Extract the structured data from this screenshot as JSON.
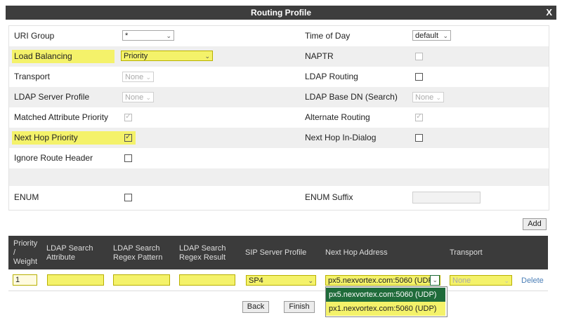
{
  "window": {
    "title": "Routing Profile",
    "close_label": "X"
  },
  "form": {
    "uri_group": {
      "label": "URI Group",
      "value": "*"
    },
    "time_of_day": {
      "label": "Time of Day",
      "value": "default"
    },
    "load_balancing": {
      "label": "Load Balancing",
      "value": "Priority"
    },
    "naptr": {
      "label": "NAPTR",
      "checked": false,
      "disabled": true
    },
    "transport": {
      "label": "Transport",
      "value": "None"
    },
    "ldap_routing": {
      "label": "LDAP Routing",
      "checked": false
    },
    "ldap_server_profile": {
      "label": "LDAP Server Profile",
      "value": "None"
    },
    "ldap_base_dn": {
      "label": "LDAP Base DN (Search)",
      "value": "None"
    },
    "matched_attribute_priority": {
      "label": "Matched Attribute Priority",
      "checked": true,
      "disabled": true
    },
    "alternate_routing": {
      "label": "Alternate Routing",
      "checked": true,
      "disabled": true
    },
    "next_hop_priority": {
      "label": "Next Hop Priority",
      "checked": true
    },
    "next_hop_in_dialog": {
      "label": "Next Hop In-Dialog",
      "checked": false
    },
    "ignore_route_header": {
      "label": "Ignore Route Header",
      "checked": false
    },
    "enum": {
      "label": "ENUM",
      "checked": false
    },
    "enum_suffix": {
      "label": "ENUM Suffix",
      "value": ""
    }
  },
  "buttons": {
    "add": "Add",
    "back": "Back",
    "finish": "Finish",
    "delete": "Delete"
  },
  "table": {
    "headers": {
      "priority_weight": [
        "Priority",
        "/",
        "Weight"
      ],
      "ldap_search_attribute": [
        "LDAP Search",
        "Attribute"
      ],
      "ldap_search_regex_pattern": [
        "LDAP Search",
        "Regex Pattern"
      ],
      "ldap_search_regex_result": [
        "LDAP Search",
        "Regex Result"
      ],
      "sip_server_profile": "SIP Server Profile",
      "next_hop_address": "Next Hop Address",
      "transport": "Transport"
    },
    "row": {
      "priority_weight": "1",
      "ldap_search_attribute": "",
      "ldap_search_regex_pattern": "",
      "ldap_search_regex_result": "",
      "sip_server_profile": "SP4",
      "next_hop_address": "px5.nexvortex.com:5060 (UDP)",
      "transport": "None"
    },
    "next_hop_options": [
      "px5.nexvortex.com:5060 (UDP)",
      "px1.nexvortex.com:5060 (UDP)"
    ]
  },
  "colors": {
    "highlight": "#f4f26a",
    "header_bg": "#3b3b3b",
    "selected_option": "#1f6b3a",
    "link": "#4a7eb6"
  }
}
